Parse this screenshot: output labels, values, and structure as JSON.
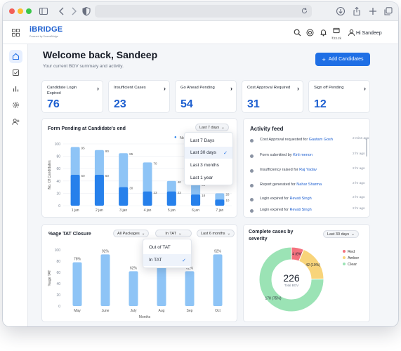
{
  "app": {
    "logo": "iBRIDGE",
    "logo_sub": "Powered by SourceBridge",
    "user": "Hi Sandeep",
    "credits": "₹23.2k"
  },
  "welcome": {
    "title": "Welcome back, Sandeep",
    "subtitle": "Your current BGV summary and activity.",
    "add_label": "Add Candidates"
  },
  "stats": [
    {
      "label": "Candidate Login Expired",
      "value": "76"
    },
    {
      "label": "Insufficient Cases",
      "value": "23"
    },
    {
      "label": "Go Ahead Pending",
      "value": "54"
    },
    {
      "label": "Cost Approval Required",
      "value": "31"
    },
    {
      "label": "Sign off Pending",
      "value": "12"
    }
  ],
  "pending_panel": {
    "title": "Form Pending at Candidate's end",
    "range": "Last 7 days",
    "legend_partial": "No",
    "dropdown": [
      "Last 7 Days",
      "Last 30 days",
      "Last 3 months",
      "Last 1 year"
    ],
    "selected": "Last 30 days"
  },
  "activity": {
    "title": "Activity feed",
    "items": [
      {
        "text": "Cost Approval requested for",
        "who": "Gautam Gosh",
        "time": "2 mins ago"
      },
      {
        "text": "Form submitted by",
        "who": "Kirti menon",
        "time": "2 hr ago"
      },
      {
        "text": "Insufficiency raised for",
        "who": "Raj Yadav",
        "time": "2 hr ago"
      },
      {
        "text": "Report generated for",
        "who": "Nahar Sharma",
        "time": "2 hr ago"
      },
      {
        "text": "Login expired for",
        "who": "Revati Singh",
        "time": "2 hr ago"
      },
      {
        "text": "Login expired for",
        "who": "Revati Singh",
        "time": "2 hr ago"
      }
    ]
  },
  "tat_panel": {
    "title": "%age TAT Closure",
    "filter_packages": "All Packages",
    "filter_tat": "In TAT",
    "filter_range": "Last 6 months",
    "dropdown": [
      "Out of TAT",
      "In TAT"
    ],
    "selected": "In TAT"
  },
  "severity_panel": {
    "title": "Complete cases by severity",
    "range": "Last 30 days",
    "total_value": "226",
    "total_label": "Total BGV"
  },
  "chart_data": [
    {
      "type": "bar",
      "title": "Form Pending at Candidate's end",
      "ylabel": "No. Of Candidates",
      "categories": [
        "1 jan",
        "2 jan",
        "3 jan",
        "4 jan",
        "5 jan",
        "6 jan",
        "7 jan"
      ],
      "ylim": [
        0,
        100
      ],
      "yticks": [
        0,
        20,
        40,
        60,
        80,
        100
      ],
      "series": [
        {
          "values": [
            95,
            90,
            85,
            70,
            40,
            35,
            20
          ],
          "color": "#8ec4f6"
        },
        {
          "values": [
            50,
            50,
            30,
            23,
            23,
            18,
            10
          ],
          "color": "#2680eb"
        }
      ],
      "labels_top": [
        95,
        90,
        85,
        70,
        40,
        35,
        20
      ],
      "labels_inner": [
        50,
        50,
        30,
        23,
        23,
        18,
        10
      ]
    },
    {
      "type": "bar",
      "title": "%age TAT Closure",
      "ylabel": "%age TAT",
      "xlabel": "Months",
      "categories": [
        "May",
        "June",
        "July",
        "Aug",
        "Sep",
        "Oct"
      ],
      "ylim": [
        0,
        100
      ],
      "yticks": [
        0,
        20,
        40,
        60,
        80,
        100
      ],
      "values": [
        78,
        92,
        62,
        80,
        62,
        92
      ],
      "labels": [
        "78%",
        "92%",
        "62%",
        "",
        "62%",
        "92%"
      ],
      "color": "#8ec4f6"
    },
    {
      "type": "pie",
      "title": "Complete cases by severity",
      "total": 226,
      "slices": [
        {
          "name": "Red",
          "value": 14,
          "label": "14 (6%)",
          "color": "#f4727e"
        },
        {
          "name": "Amber",
          "value": 42,
          "label": "42 (19%)",
          "color": "#f8d47a"
        },
        {
          "name": "Clear",
          "value": 170,
          "label": "170 (75%)",
          "color": "#9be3b5"
        }
      ]
    }
  ]
}
